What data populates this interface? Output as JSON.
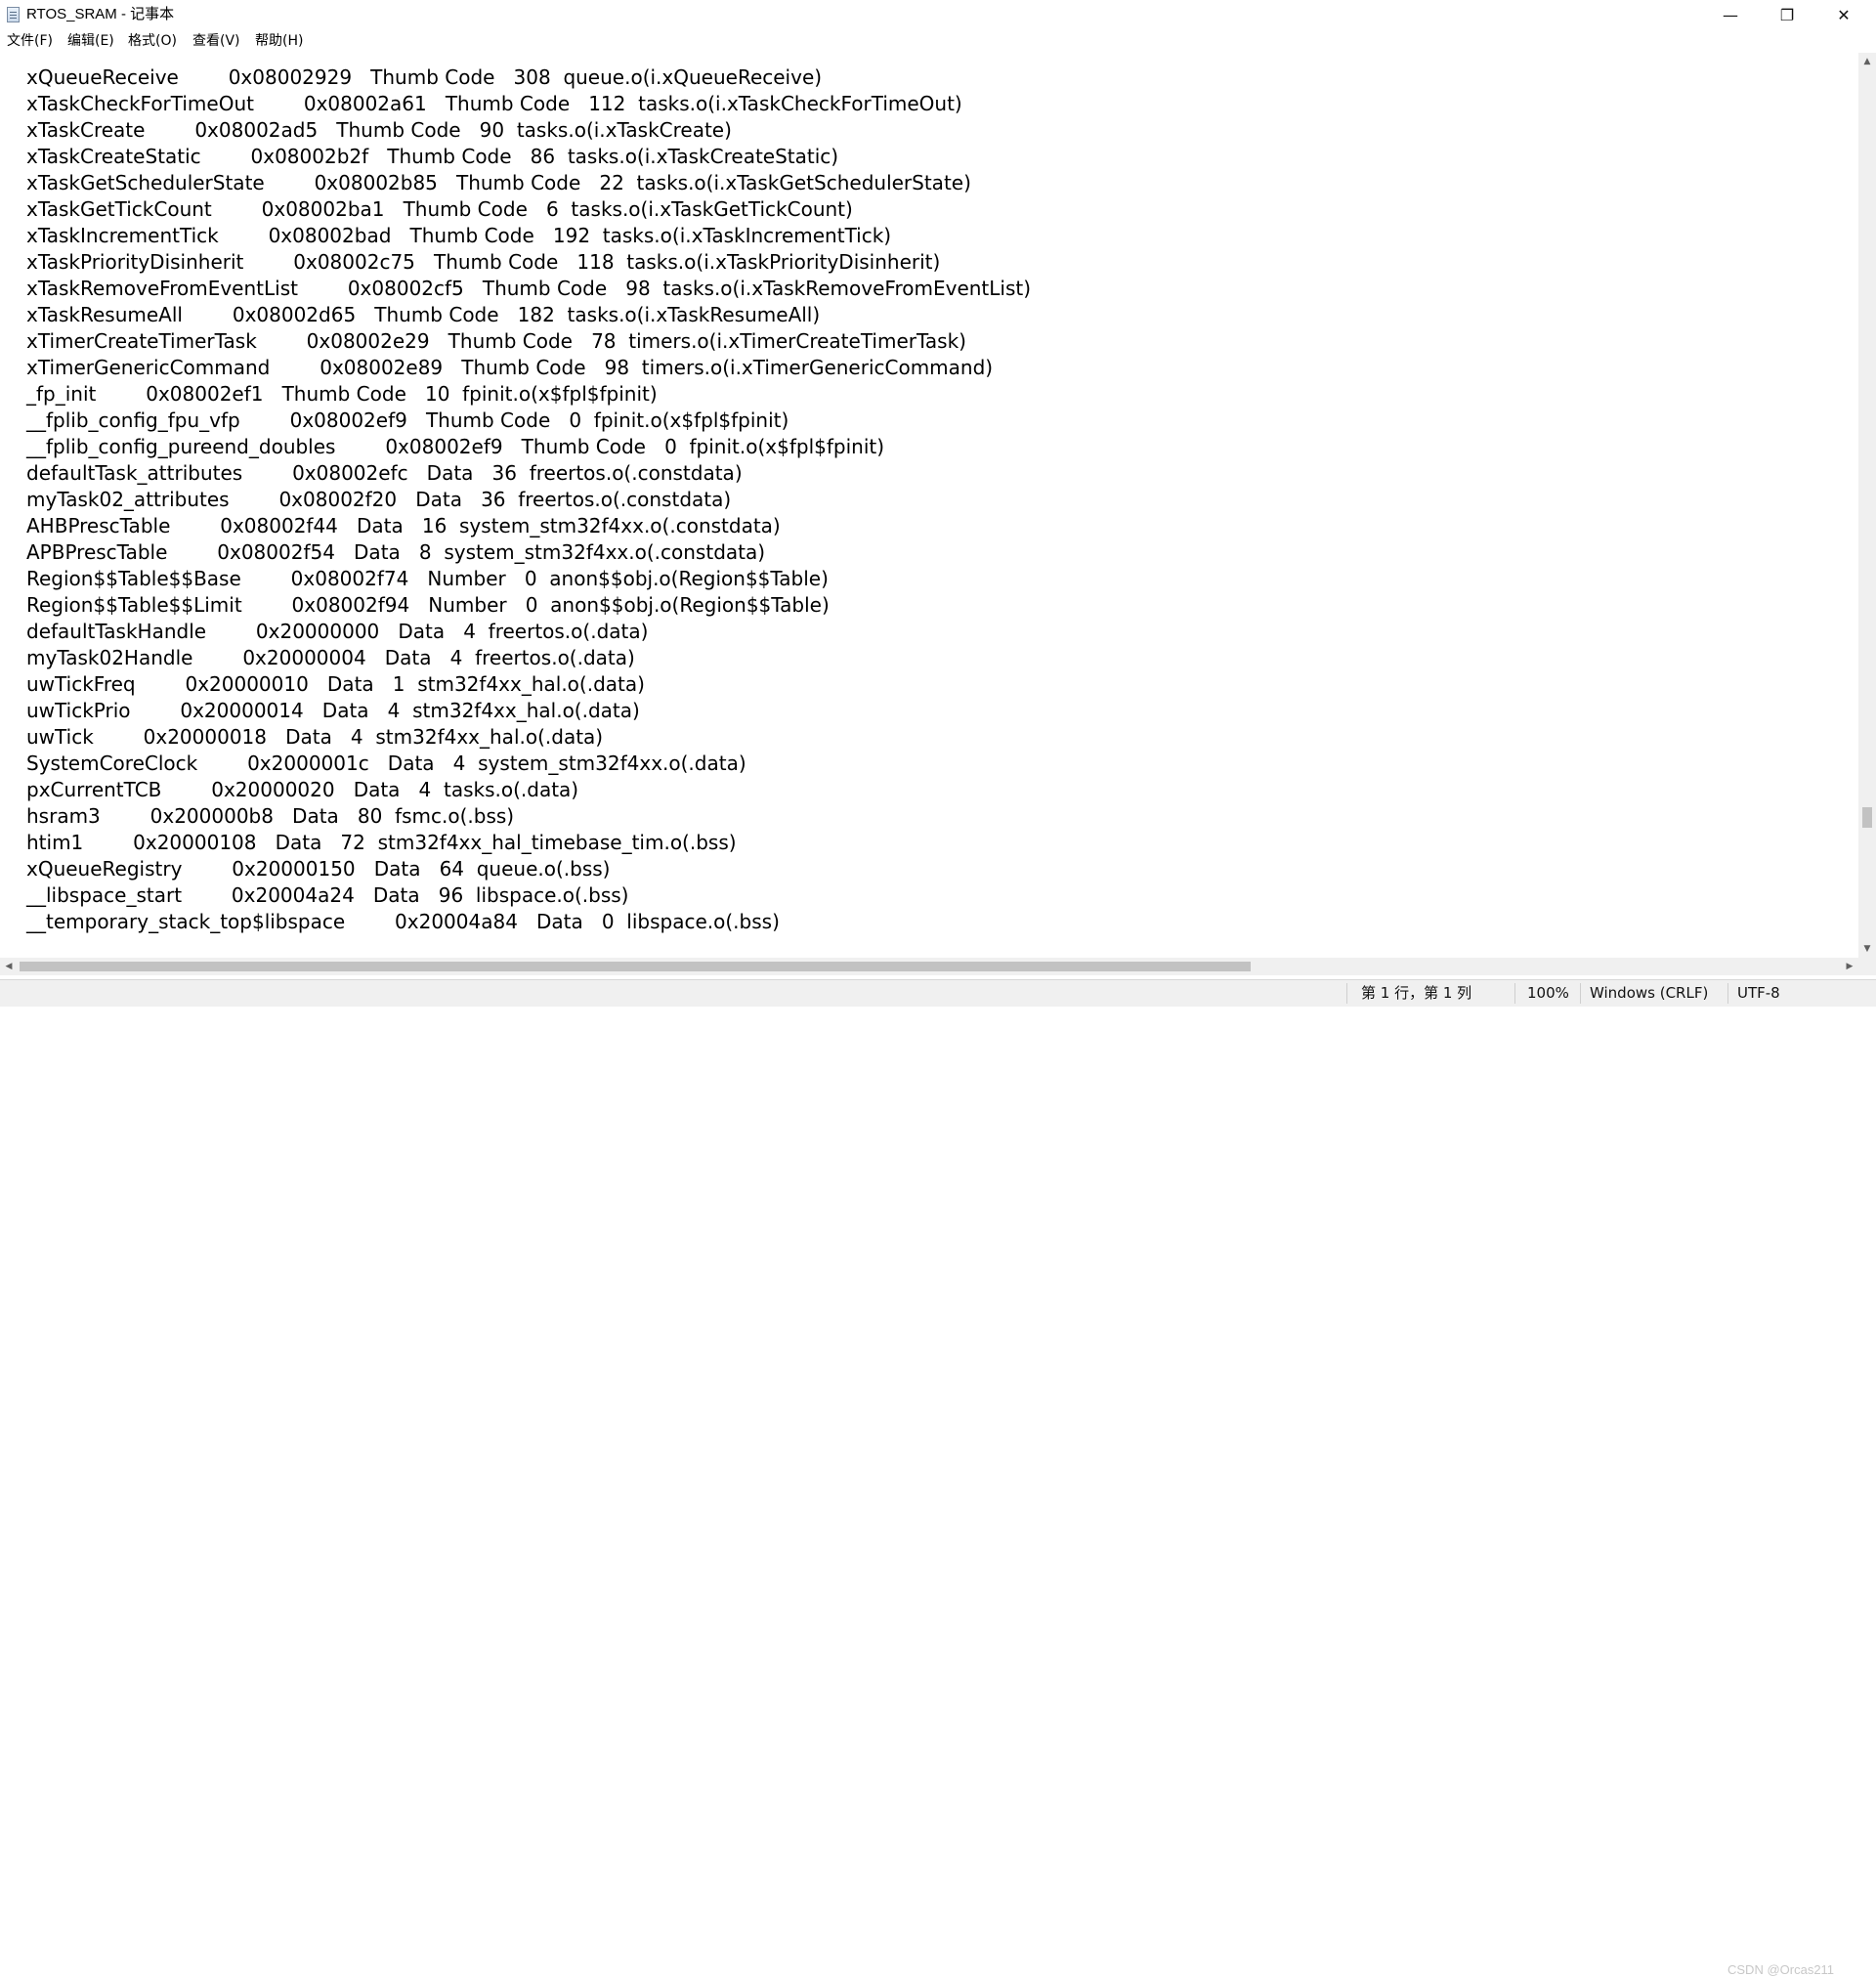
{
  "window": {
    "title": "RTOS_SRAM - 记事本",
    "controls": {
      "minimize": "—",
      "maximize": "❐",
      "close": "✕"
    }
  },
  "menu": [
    "文件(F)",
    "编辑(E)",
    "格式(O)",
    "查看(V)",
    "帮助(H)"
  ],
  "lines": [
    {
      "name": "xQueueReceive",
      "addr": "0x08002929",
      "type": "Thumb Code",
      "size": "308",
      "object": "queue.o(i.xQueueReceive)"
    },
    {
      "name": "xTaskCheckForTimeOut",
      "addr": "0x08002a61",
      "type": "Thumb Code",
      "size": "112",
      "object": "tasks.o(i.xTaskCheckForTimeOut)"
    },
    {
      "name": "xTaskCreate",
      "addr": "0x08002ad5",
      "type": "Thumb Code",
      "size": "90",
      "object": "tasks.o(i.xTaskCreate)"
    },
    {
      "name": "xTaskCreateStatic",
      "addr": "0x08002b2f",
      "type": "Thumb Code",
      "size": "86",
      "object": "tasks.o(i.xTaskCreateStatic)"
    },
    {
      "name": "xTaskGetSchedulerState",
      "addr": "0x08002b85",
      "type": "Thumb Code",
      "size": "22",
      "object": "tasks.o(i.xTaskGetSchedulerState)"
    },
    {
      "name": "xTaskGetTickCount",
      "addr": "0x08002ba1",
      "type": "Thumb Code",
      "size": "6",
      "object": "tasks.o(i.xTaskGetTickCount)"
    },
    {
      "name": "xTaskIncrementTick",
      "addr": "0x08002bad",
      "type": "Thumb Code",
      "size": "192",
      "object": "tasks.o(i.xTaskIncrementTick)"
    },
    {
      "name": "xTaskPriorityDisinherit",
      "addr": "0x08002c75",
      "type": "Thumb Code",
      "size": "118",
      "object": "tasks.o(i.xTaskPriorityDisinherit)"
    },
    {
      "name": "xTaskRemoveFromEventList",
      "addr": "0x08002cf5",
      "type": "Thumb Code",
      "size": "98",
      "object": "tasks.o(i.xTaskRemoveFromEventList)"
    },
    {
      "name": "xTaskResumeAll",
      "addr": "0x08002d65",
      "type": "Thumb Code",
      "size": "182",
      "object": "tasks.o(i.xTaskResumeAll)"
    },
    {
      "name": "xTimerCreateTimerTask",
      "addr": "0x08002e29",
      "type": "Thumb Code",
      "size": "78",
      "object": "timers.o(i.xTimerCreateTimerTask)"
    },
    {
      "name": "xTimerGenericCommand",
      "addr": "0x08002e89",
      "type": "Thumb Code",
      "size": "98",
      "object": "timers.o(i.xTimerGenericCommand)"
    },
    {
      "name": "_fp_init",
      "addr": "0x08002ef1",
      "type": "Thumb Code",
      "size": "10",
      "object": "fpinit.o(x$fpl$fpinit)"
    },
    {
      "name": "__fplib_config_fpu_vfp",
      "addr": "0x08002ef9",
      "type": "Thumb Code",
      "size": "0",
      "object": "fpinit.o(x$fpl$fpinit)"
    },
    {
      "name": "__fplib_config_pureend_doubles",
      "addr": "0x08002ef9",
      "type": "Thumb Code",
      "size": "0",
      "object": "fpinit.o(x$fpl$fpinit)"
    },
    {
      "name": "defaultTask_attributes",
      "addr": "0x08002efc",
      "type": "Data",
      "size": "36",
      "object": "freertos.o(.constdata)"
    },
    {
      "name": "myTask02_attributes",
      "addr": "0x08002f20",
      "type": "Data",
      "size": "36",
      "object": "freertos.o(.constdata)"
    },
    {
      "name": "AHBPrescTable",
      "addr": "0x08002f44",
      "type": "Data",
      "size": "16",
      "object": "system_stm32f4xx.o(.constdata)"
    },
    {
      "name": "APBPrescTable",
      "addr": "0x08002f54",
      "type": "Data",
      "size": "8",
      "object": "system_stm32f4xx.o(.constdata)"
    },
    {
      "name": "Region$$Table$$Base",
      "addr": "0x08002f74",
      "type": "Number",
      "size": "0",
      "object": "anon$$obj.o(Region$$Table)"
    },
    {
      "name": "Region$$Table$$Limit",
      "addr": "0x08002f94",
      "type": "Number",
      "size": "0",
      "object": "anon$$obj.o(Region$$Table)"
    },
    {
      "name": "defaultTaskHandle",
      "addr": "0x20000000",
      "type": "Data",
      "size": "4",
      "object": "freertos.o(.data)"
    },
    {
      "name": "myTask02Handle",
      "addr": "0x20000004",
      "type": "Data",
      "size": "4",
      "object": "freertos.o(.data)"
    },
    {
      "name": "uwTickFreq",
      "addr": "0x20000010",
      "type": "Data",
      "size": "1",
      "object": "stm32f4xx_hal.o(.data)"
    },
    {
      "name": "uwTickPrio",
      "addr": "0x20000014",
      "type": "Data",
      "size": "4",
      "object": "stm32f4xx_hal.o(.data)"
    },
    {
      "name": "uwTick",
      "addr": "0x20000018",
      "type": "Data",
      "size": "4",
      "object": "stm32f4xx_hal.o(.data)"
    },
    {
      "name": "SystemCoreClock",
      "addr": "0x2000001c",
      "type": "Data",
      "size": "4",
      "object": "system_stm32f4xx.o(.data)"
    },
    {
      "name": "pxCurrentTCB",
      "addr": "0x20000020",
      "type": "Data",
      "size": "4",
      "object": "tasks.o(.data)"
    },
    {
      "name": "hsram3",
      "addr": "0x200000b8",
      "type": "Data",
      "size": "80",
      "object": "fsmc.o(.bss)"
    },
    {
      "name": "htim1",
      "addr": "0x20000108",
      "type": "Data",
      "size": "72",
      "object": "stm32f4xx_hal_timebase_tim.o(.bss)"
    },
    {
      "name": "xQueueRegistry",
      "addr": "0x20000150",
      "type": "Data",
      "size": "64",
      "object": "queue.o(.bss)"
    },
    {
      "name": "__libspace_start",
      "addr": "0x20004a24",
      "type": "Data",
      "size": "96",
      "object": "libspace.o(.bss)"
    },
    {
      "name": "__temporary_stack_top$libspace",
      "addr": "0x20004a84",
      "type": "Data",
      "size": "0",
      "object": "libspace.o(.bss)"
    }
  ],
  "status": {
    "position": "第 1 行，第 1 列",
    "zoom": "100%",
    "line_ending": "Windows (CRLF)",
    "encoding": "UTF-8"
  },
  "watermark": "CSDN @Orcas211",
  "scroll": {
    "vertical_position_fraction": 0.87,
    "horizontal_visible_fraction": 0.66
  }
}
